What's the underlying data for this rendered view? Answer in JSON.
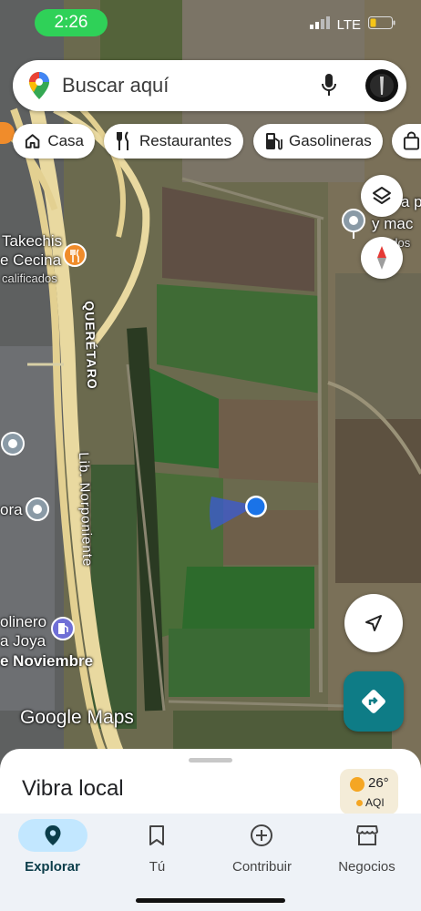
{
  "status_bar": {
    "time": "2:26",
    "network": "LTE"
  },
  "search": {
    "placeholder": "Buscar aquí"
  },
  "chips": [
    {
      "label": "Casa",
      "icon": "home-icon"
    },
    {
      "label": "Restaurantes",
      "icon": "fork-knife-icon"
    },
    {
      "label": "Gasolineras",
      "icon": "gas-station-icon"
    }
  ],
  "map": {
    "places": {
      "takechis_1": "Takechis",
      "takechis_2": "e Cecina",
      "takechis_3": "calificados",
      "right_1": "a p",
      "right_2": "y mac",
      "right_3": "ados",
      "left_ora": "ora",
      "left_olinero": "olinero",
      "left_joya": "a Joya",
      "left_noviembre": "e Noviembre"
    },
    "roads": {
      "queretaro": "QUERÉTARO",
      "norponiente": "Lib. Norponiente"
    },
    "attribution": "Google Maps"
  },
  "sheet": {
    "title": "Vibra local",
    "weather": {
      "temp": "26°",
      "aqi": "AQI"
    }
  },
  "bottom_nav": [
    {
      "label": "Explorar",
      "icon": "location-pin-icon",
      "active": true
    },
    {
      "label": "Tú",
      "icon": "bookmark-icon",
      "active": false
    },
    {
      "label": "Contribuir",
      "icon": "add-circle-icon",
      "active": false
    },
    {
      "label": "Negocios",
      "icon": "storefront-icon",
      "active": false
    }
  ],
  "colors": {
    "accent_teal": "#0e7c86",
    "location_blue": "#1a73e8",
    "status_green": "#2fd158",
    "nav_active": "#c2e7ff"
  }
}
